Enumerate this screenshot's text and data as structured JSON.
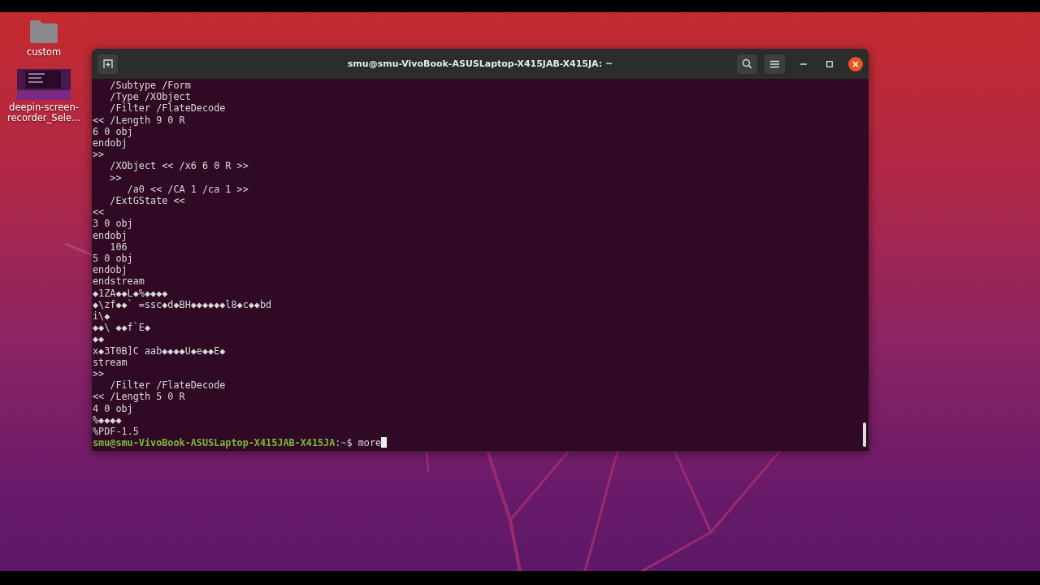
{
  "desktop": {
    "icons": [
      {
        "label": "custom",
        "kind": "folder"
      },
      {
        "label": "deepin-screen-recorder_Sele...",
        "kind": "thumbnail"
      }
    ]
  },
  "terminal": {
    "title": "smu@smu-VivoBook-ASUSLaptop-X415JAB-X415JA: ~",
    "lines": [
      "   /Subtype /Form",
      "   /Type /XObject",
      "   /Filter /FlateDecode",
      "<< /Length 9 0 R",
      "6 0 obj",
      "endobj",
      ">>",
      "   /XObject << /x6 6 0 R >>",
      "   >>",
      "      /a0 << /CA 1 /ca 1 >>",
      "   /ExtGState <<",
      "<<",
      "3 0 obj",
      "endobj",
      "   106",
      "5 0 obj",
      "endobj",
      "endstream",
      "◆1ZA◆◆L◆%◆◆◆◆",
      "◆\\zf◆◆` =ssc◆d◆BH◆◆◆◆◆◆l8◆c◆◆bd",
      "i\\◆",
      "◆◆\\ ◆◆f`E◆",
      "◆◆",
      "x◆3T0B]C aab◆◆◆◆U◆e◆◆E◆",
      "stream",
      ">>",
      "   /Filter /FlateDecode",
      "<< /Length 5 0 R",
      "4 0 obj",
      "%◆◆◆◆",
      "%PDF-1.5"
    ],
    "prompt": {
      "user_host": "smu@smu-VivoBook-ASUSLaptop-X415JAB-X415JA",
      "separator": ":",
      "path": "~",
      "symbol": "$",
      "command": "more"
    }
  }
}
